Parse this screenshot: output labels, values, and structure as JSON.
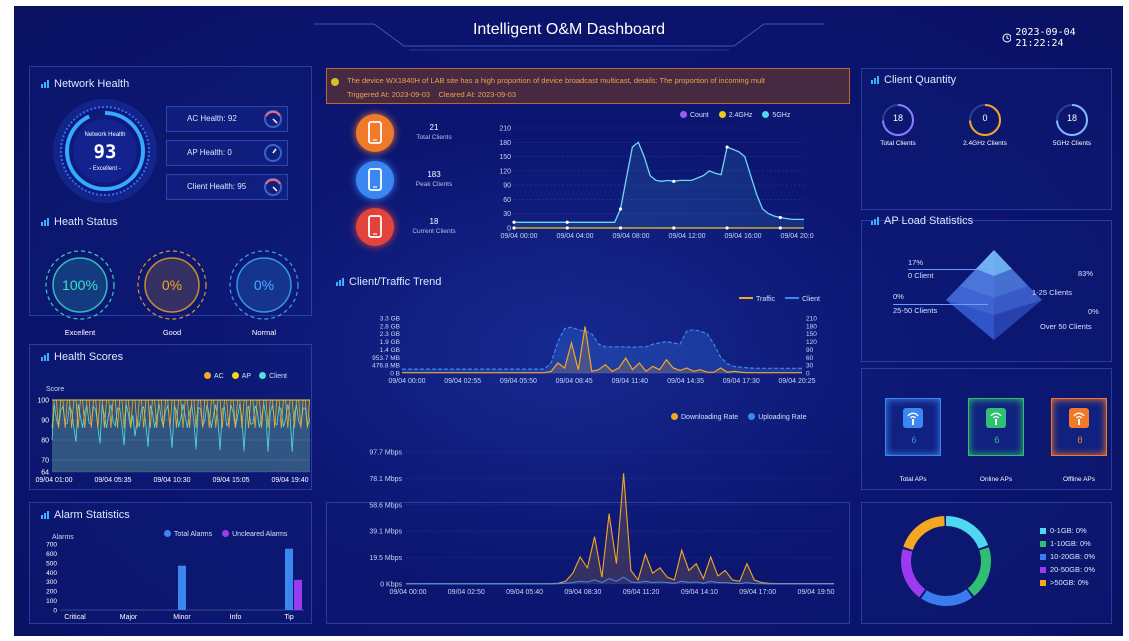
{
  "header": {
    "title": "Intelligent O&M Dashboard",
    "datetime": "2023-09-04 21:22:24",
    "clock_icon": "clock-icon"
  },
  "network_health": {
    "title": "Network Health",
    "gauge_label": "Network Health",
    "score": "93",
    "score_value": 93,
    "grade": "- Excellent -",
    "items": [
      {
        "label": "AC Health: 92",
        "value": 92
      },
      {
        "label": "AP Health: 0",
        "value": 0
      },
      {
        "label": "Client Health: 95",
        "value": 95
      }
    ]
  },
  "health_status": {
    "title": "Heath Status",
    "items": [
      {
        "value": "100%",
        "label": "Excellent",
        "color": "#3de0c8"
      },
      {
        "value": "0%",
        "label": "Good",
        "color": "#f5a623"
      },
      {
        "value": "0%",
        "label": "Normal",
        "color": "#3fb0ff"
      }
    ]
  },
  "health_scores": {
    "title": "Health Scores",
    "legend": [
      "AC",
      "AP",
      "Client"
    ],
    "ylabel": "Score"
  },
  "alarm": {
    "title": "Alarm Statistics",
    "legend": [
      "Total Alarms",
      "Uncleared Alarms"
    ],
    "ylabel": "Alarms"
  },
  "alert": {
    "message": "The device WX1840H of LAB site has a high proportion of device broadcast multicast, details: The proportion of incoming mult",
    "triggered": "Triggered At: 2023-09-03",
    "cleared": "Cleared At: 2023-09-03"
  },
  "client_stats": [
    {
      "value": "21",
      "label": "Total Clients",
      "color": "#f07a2a",
      "icon": "mobile-phone-icon"
    },
    {
      "value": "183",
      "label": "Peak Clients",
      "color": "#3b86f0",
      "icon": "mobile-phone-icon"
    },
    {
      "value": "18",
      "label": "Current Clients",
      "color": "#e2433a",
      "icon": "mobile-phone-icon"
    }
  ],
  "trend": {
    "title": "Client/Traffic Trend"
  },
  "client_quantity": {
    "title": "Client Quantity",
    "items": [
      {
        "value": "18",
        "label": "Total Clients",
        "color": "#8b7cff"
      },
      {
        "value": "0",
        "label": "2.4GHz Clients",
        "color": "#f5a623"
      },
      {
        "value": "18",
        "label": "5GHz Clients",
        "color": "#7fb8ff"
      }
    ]
  },
  "ap_load": {
    "title": "AP Load Statistics",
    "labels": [
      {
        "pct": "17%",
        "name": "0 Client"
      },
      {
        "pct": "83%",
        "name": "1-25 Clients"
      },
      {
        "pct": "0%",
        "name": "25-50 Clients"
      },
      {
        "pct": "0%",
        "name": "Over 50 Clients"
      }
    ]
  },
  "ap_stats": [
    {
      "value": "6",
      "label": "Total APs",
      "color": "#3b86f0"
    },
    {
      "value": "6",
      "label": "Online APs",
      "color": "#2fbf71"
    },
    {
      "value": "0",
      "label": "Offline APs",
      "color": "#f07a2a"
    }
  ],
  "storage": {
    "legend": [
      {
        "label": "0-1GB: 0%",
        "color": "#4fd6f0"
      },
      {
        "label": "1-10GB: 0%",
        "color": "#2fbf71"
      },
      {
        "label": "10-20GB: 0%",
        "color": "#3b7bf0"
      },
      {
        "label": "20-50GB: 0%",
        "color": "#9b3bf0"
      },
      {
        "label": ">50GB: 0%",
        "color": "#f5a623"
      }
    ]
  },
  "chart_data": [
    {
      "type": "line",
      "legend": [
        "Count",
        "2.4GHz",
        "5GHz"
      ],
      "colors": [
        "#9b5cf6",
        "#f5c518",
        "#4fd6f0"
      ],
      "x_ticks": [
        "09/04 00:00",
        "09/04 04:00",
        "09/04 08:00",
        "09/04 12:00",
        "09/04 16:00",
        "09/04 20:00"
      ],
      "y_ticks": [
        "0",
        "30",
        "60",
        "90",
        "120",
        "150",
        "180",
        "210"
      ],
      "ylim": [
        0,
        210
      ],
      "series": [
        {
          "name": "Count",
          "values": [
            12,
            12,
            12,
            12,
            12,
            12,
            12,
            12,
            12,
            12,
            12,
            12,
            12,
            12,
            12,
            12,
            12,
            12,
            40,
            105,
            170,
            180,
            150,
            110,
            100,
            98,
            100,
            98,
            100,
            100,
            100,
            105,
            110,
            120,
            115,
            112,
            170,
            165,
            160,
            150,
            110,
            70,
            40,
            30,
            25,
            22,
            20,
            18,
            18,
            18
          ]
        },
        {
          "name": "2.4GHz",
          "values": [
            0,
            0,
            0,
            0,
            0,
            0,
            0,
            0,
            0,
            0,
            0,
            0,
            0,
            0,
            0,
            0,
            0,
            0,
            0,
            0,
            0,
            0,
            0,
            0,
            0,
            0,
            0,
            0,
            0,
            0,
            0,
            0,
            0,
            0,
            0,
            0,
            0,
            0,
            0,
            0,
            0,
            0,
            0,
            0,
            0,
            0,
            0,
            0,
            0,
            0
          ]
        },
        {
          "name": "5GHz",
          "values": [
            12,
            12,
            12,
            12,
            12,
            12,
            12,
            12,
            12,
            12,
            12,
            12,
            12,
            12,
            12,
            12,
            12,
            12,
            40,
            105,
            170,
            180,
            150,
            110,
            100,
            98,
            100,
            98,
            100,
            100,
            100,
            105,
            110,
            120,
            115,
            112,
            170,
            165,
            160,
            150,
            110,
            70,
            40,
            30,
            25,
            22,
            20,
            18,
            18,
            18
          ]
        }
      ]
    },
    {
      "type": "line",
      "legend": [
        "Traffic",
        "Client"
      ],
      "colors": [
        "#f5a623",
        "#3b86f0"
      ],
      "x_ticks": [
        "09/04 00:00",
        "09/04 02:55",
        "09/04 05:50",
        "09/04 08:45",
        "09/04 11:40",
        "09/04 14:35",
        "09/04 17:30",
        "09/04 20:25"
      ],
      "y_left_ticks": [
        "0 B",
        "476.8 MB",
        "953.7 MB",
        "1.4 GB",
        "1.9 GB",
        "2.3 GB",
        "2.8 GB",
        "3.3 GB"
      ],
      "y_right_ticks": [
        "0",
        "30",
        "60",
        "90",
        "120",
        "150",
        "180",
        "210"
      ],
      "series": [
        {
          "name": "Traffic",
          "values": [
            0.02,
            0.02,
            0.02,
            0.02,
            0.02,
            0.02,
            0.02,
            0.02,
            0.02,
            0.02,
            0.02,
            0.02,
            0.02,
            0.02,
            0.02,
            0.02,
            0.02,
            0.02,
            0.02,
            0.02,
            0.02,
            0.02,
            0.1,
            0.6,
            0.3,
            1.8,
            0.2,
            2.8,
            0.1,
            0.2,
            0.5,
            0.1,
            0.3,
            0.9,
            0.2,
            0.6,
            0.1,
            0.4,
            0.2,
            0.8,
            0.3,
            0.15,
            0.3,
            0.1,
            0.2,
            0.05,
            0.05,
            0.3,
            0.05,
            0.1,
            0.05,
            0.02,
            0.02,
            0.02,
            0.02,
            0.02,
            0.02,
            0.02,
            0.02,
            0.02
          ]
        },
        {
          "name": "Client",
          "values": [
            15,
            15,
            15,
            15,
            15,
            15,
            15,
            15,
            15,
            15,
            15,
            15,
            15,
            15,
            15,
            15,
            15,
            15,
            15,
            15,
            15,
            15,
            40,
            120,
            170,
            175,
            165,
            160,
            150,
            110,
            100,
            100,
            100,
            100,
            98,
            100,
            100,
            110,
            115,
            120,
            115,
            110,
            160,
            165,
            160,
            150,
            110,
            60,
            35,
            25,
            22,
            20,
            18,
            18,
            18,
            18,
            18,
            18,
            18,
            18
          ]
        }
      ]
    },
    {
      "type": "line",
      "legend": [
        "Downloading Rate",
        "Uploading Rate"
      ],
      "colors": [
        "#f5a623",
        "#3b86f0"
      ],
      "x_ticks": [
        "09/04 00:00",
        "09/04 02:50",
        "09/04 05:40",
        "09/04 08:30",
        "09/04 11:20",
        "09/04 14:10",
        "09/04 17:00",
        "09/04 19:50"
      ],
      "y_ticks": [
        "0 Kbps",
        "19.5 Mbps",
        "39.1 Mbps",
        "58.6 Mbps",
        "78.1 Mbps",
        "97.7 Mbps"
      ],
      "ylim": [
        0,
        97.7
      ],
      "series": [
        {
          "name": "Downloading Rate",
          "values": [
            0.2,
            0.2,
            0.2,
            0.2,
            0.2,
            0.2,
            0.2,
            0.2,
            0.2,
            0.2,
            0.2,
            0.2,
            0.2,
            0.2,
            0.2,
            0.2,
            0.2,
            0.2,
            0.2,
            0.2,
            0.3,
            0.5,
            2,
            8,
            20,
            12,
            35,
            5,
            52,
            15,
            82,
            10,
            3,
            22,
            8,
            12,
            5,
            3,
            25,
            10,
            15,
            4,
            20,
            6,
            10,
            3,
            2,
            15,
            3,
            1,
            0.5,
            0.3,
            0.3,
            0.3,
            0.3,
            0.3,
            0.3,
            0.3,
            0.3,
            0.3
          ]
        },
        {
          "name": "Uploading Rate",
          "values": [
            0.1,
            0.1,
            0.1,
            0.1,
            0.1,
            0.1,
            0.1,
            0.1,
            0.1,
            0.1,
            0.1,
            0.1,
            0.1,
            0.1,
            0.1,
            0.1,
            0.1,
            0.1,
            0.1,
            0.1,
            0.1,
            0.2,
            0.5,
            1,
            2,
            1.5,
            3,
            1,
            4,
            2,
            5,
            1.5,
            1,
            2,
            1,
            1.5,
            1,
            0.5,
            2,
            1,
            1.5,
            0.5,
            2,
            1,
            1,
            0.5,
            0.3,
            1,
            0.3,
            0.2,
            0.1,
            0.1,
            0.1,
            0.1,
            0.1,
            0.1,
            0.1,
            0.1,
            0.1,
            0.1
          ]
        }
      ]
    },
    {
      "type": "line",
      "title": "Health Scores",
      "legend": [
        "AC",
        "AP",
        "Client"
      ],
      "colors": [
        "#f5a623",
        "#f5d318",
        "#4fe0d8"
      ],
      "x_ticks": [
        "09/04 01:00",
        "09/04 05:35",
        "09/04 10:30",
        "09/04 15:05",
        "09/04 19:40"
      ],
      "y_ticks": [
        "64",
        "70",
        "80",
        "90",
        "100"
      ],
      "ylim": [
        64,
        100
      ]
    },
    {
      "type": "bar",
      "title": "Alarm Statistics",
      "categories": [
        "Critical",
        "Major",
        "Minor",
        "Info",
        "Tip"
      ],
      "y_ticks": [
        "0",
        "100",
        "200",
        "300",
        "400",
        "500",
        "600",
        "700"
      ],
      "ylim": [
        0,
        700
      ],
      "series": [
        {
          "name": "Total Alarms",
          "values": [
            0,
            0,
            470,
            0,
            650
          ],
          "color": "#3b86f0"
        },
        {
          "name": "Uncleared Alarms",
          "values": [
            0,
            0,
            0,
            0,
            320
          ],
          "color": "#9b3bf0"
        }
      ]
    },
    {
      "type": "pie",
      "categories": [
        "0-1GB",
        "1-10GB",
        "10-20GB",
        "20-50GB",
        ">50GB"
      ],
      "values": [
        0,
        0,
        0,
        0,
        0
      ],
      "colors": [
        "#4fd6f0",
        "#2fbf71",
        "#3b7bf0",
        "#9b3bf0",
        "#f5a623"
      ]
    }
  ]
}
